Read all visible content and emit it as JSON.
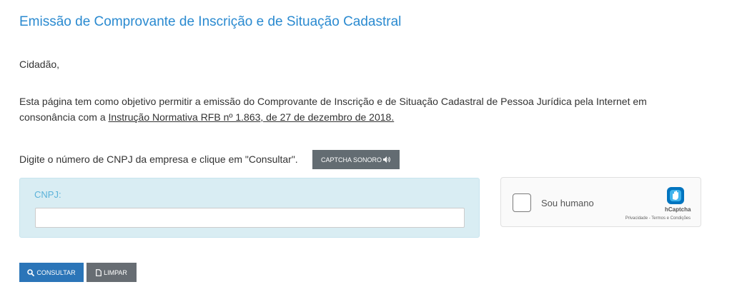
{
  "page": {
    "title": "Emissão de Comprovante de Inscrição e de Situação Cadastral",
    "greeting": "Cidadão,",
    "intro_before_link": "Esta página tem como objetivo permitir a emissão do Comprovante de Inscrição e de Situação Cadastral de Pessoa Jurídica pela Internet em consonância com a ",
    "intro_link": "Instrução Normativa RFB nº 1.863, de 27 de dezembro de 2018.",
    "instruction": "Digite o número de CNPJ da empresa e clique em \"Consultar\"."
  },
  "captcha_audio_button": {
    "label": "CAPTCHA SONORO",
    "icon": "volume-icon"
  },
  "form": {
    "cnpj_label": "CNPJ:",
    "cnpj_value": ""
  },
  "hcaptcha": {
    "label": "Sou humano",
    "brand": "hCaptcha",
    "privacy": "Privacidade",
    "separator": " - ",
    "terms": "Termos e Condições",
    "logo_color": "#0074bf"
  },
  "actions": {
    "consultar_label": "CONSULTAR",
    "consultar_icon": "search-icon",
    "limpar_label": "LIMPAR",
    "limpar_icon": "file-icon"
  },
  "colors": {
    "title": "#2a8ad0",
    "primary_button": "#2b75b8",
    "secondary_button": "#676d73",
    "panel_bg": "#d9edf3"
  }
}
